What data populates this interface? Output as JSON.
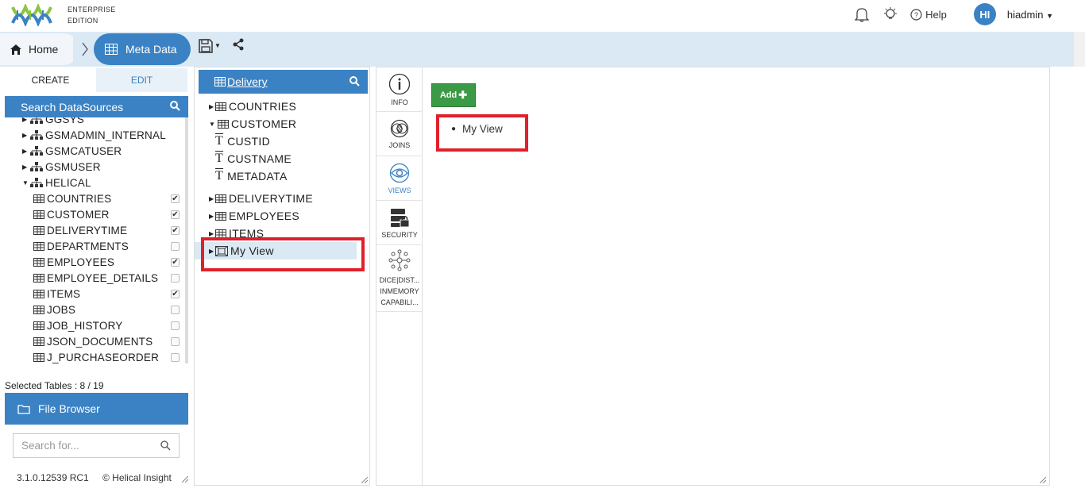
{
  "brand": {
    "line1": "ENTERPRISE",
    "line2": "EDITION"
  },
  "header": {
    "help_label": "Help",
    "avatar_initials": "HI",
    "username": "hiadmin"
  },
  "breadcrumb": {
    "home": "Home",
    "current": "Meta Data"
  },
  "left": {
    "tab_create": "CREATE",
    "tab_edit": "EDIT",
    "search_datasources": "Search DataSources",
    "schemas": [
      {
        "label": "GGSYS",
        "expanded": false
      },
      {
        "label": "GSMADMIN_INTERNAL",
        "expanded": false
      },
      {
        "label": "GSMCATUSER",
        "expanded": false
      },
      {
        "label": "GSMUSER",
        "expanded": false
      },
      {
        "label": "HELICAL",
        "expanded": true
      }
    ],
    "tables": [
      {
        "label": "COUNTRIES",
        "checked": true
      },
      {
        "label": "CUSTOMER",
        "checked": true
      },
      {
        "label": "DELIVERYTIME",
        "checked": true
      },
      {
        "label": "DEPARTMENTS",
        "checked": false
      },
      {
        "label": "EMPLOYEES",
        "checked": true
      },
      {
        "label": "EMPLOYEE_DETAILS",
        "checked": false
      },
      {
        "label": "ITEMS",
        "checked": true
      },
      {
        "label": "JOBS",
        "checked": false
      },
      {
        "label": "JOB_HISTORY",
        "checked": false
      },
      {
        "label": "JSON_DOCUMENTS",
        "checked": false
      },
      {
        "label": "J_PURCHASEORDER",
        "checked": false
      }
    ],
    "selected_tables": "Selected Tables : 8 / 19",
    "file_browser": "File Browser",
    "search_placeholder": "Search for...",
    "version": "3.1.0.12539 RC1",
    "copyright": "© Helical Insight"
  },
  "middle": {
    "title": "Delivery",
    "items": {
      "countries": "COUNTRIES",
      "customer": "CUSTOMER",
      "custid": "CUSTID",
      "custname": "CUSTNAME",
      "metadata": "METADATA",
      "deliverytime": "DELIVERYTIME",
      "employees": "EMPLOYEES",
      "items": "ITEMS",
      "myview": "My View"
    }
  },
  "right": {
    "icons": {
      "info": "INFO",
      "joins": "JOINS",
      "views": "VIEWS",
      "security": "SECURITY",
      "dice1": "DICE|DIST...",
      "dice2": "INMEMORY",
      "dice3": "CAPABILI..."
    },
    "add_label": "Add",
    "views_list": [
      "My View"
    ]
  },
  "colors": {
    "accent": "#3b82c4",
    "add_green": "#3a9a45",
    "highlight_red": "#e0202a"
  }
}
